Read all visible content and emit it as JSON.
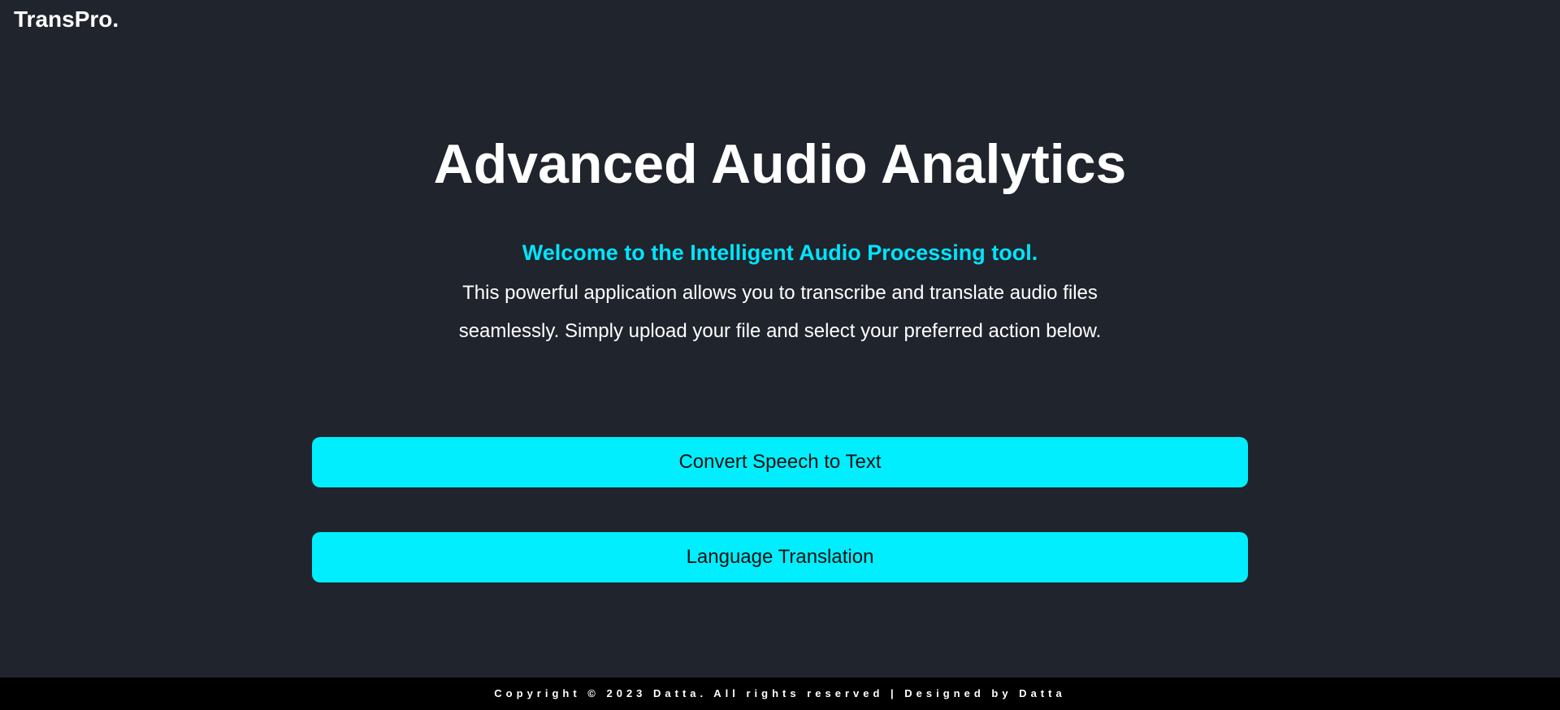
{
  "header": {
    "brand": "TransPro."
  },
  "hero": {
    "title": "Advanced Audio Analytics",
    "welcome": "Welcome to the Intelligent Audio Processing tool.",
    "description": "This powerful application allows you to transcribe and translate audio files seamlessly. Simply upload your file and select your preferred action below."
  },
  "actions": {
    "speech_to_text_label": "Convert Speech to Text",
    "translation_label": "Language Translation"
  },
  "footer": {
    "text": "Copyright © 2023 Datta. All rights reserved | Designed by Datta"
  },
  "colors": {
    "background": "#20242d",
    "accent": "#00eefe",
    "welcome_text": "#00e5ff",
    "footer_background": "#000000"
  }
}
